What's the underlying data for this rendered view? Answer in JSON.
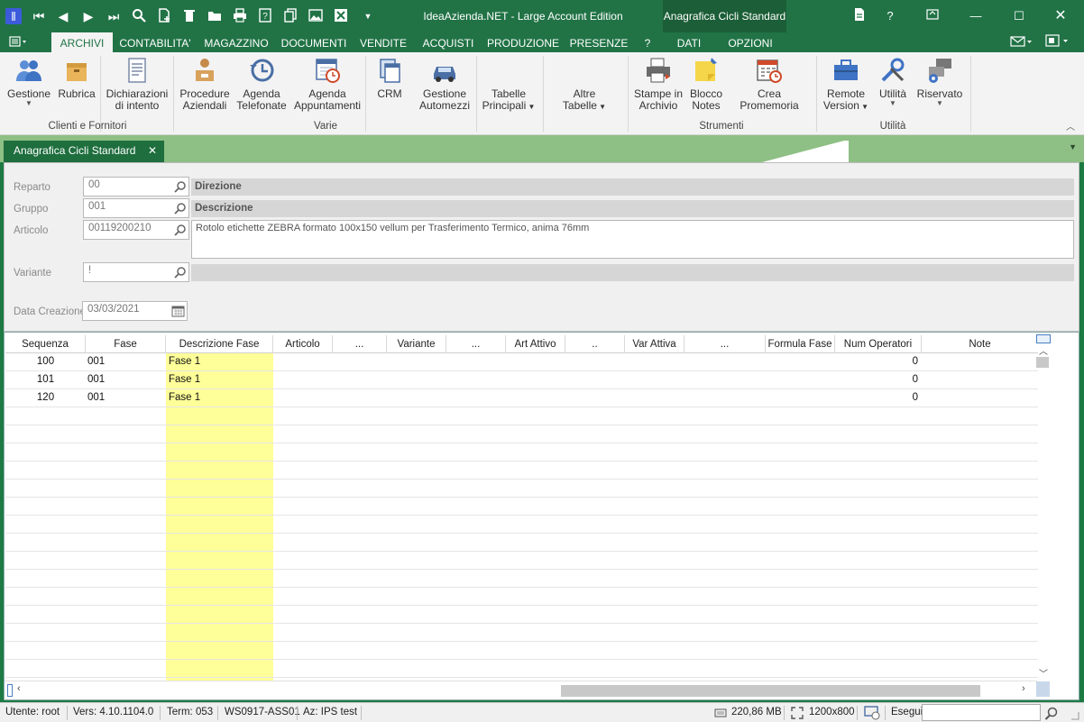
{
  "window": {
    "title": "IdeaAzienda.NET - Large Account Edition",
    "context_group": "Anagrafica Cicli Standard"
  },
  "quick_access": [
    "app-icon",
    "first-icon",
    "prev-icon",
    "next-icon",
    "last-icon",
    "search-icon",
    "new-icon",
    "delete-icon",
    "open-icon",
    "print-icon",
    "help-doc-icon",
    "copy-icon",
    "image-icon",
    "close-x-icon",
    "dropdown-icon"
  ],
  "window_controls": {
    "help": "?"
  },
  "ribbon_tabs": [
    "ARCHIVI",
    "CONTABILITA'",
    "MAGAZZINO",
    "DOCUMENTI",
    "VENDITE",
    "ACQUISTI",
    "PRODUZIONE",
    "PRESENZE",
    "?",
    "DATI",
    "OPZIONI"
  ],
  "ribbon": {
    "buttons": [
      {
        "label": "Gestione",
        "label2": "",
        "dropdown": true
      },
      {
        "label": "Rubrica",
        "label2": "",
        "dropdown": false
      },
      {
        "label": "Dichiarazioni",
        "label2": "di intento",
        "dropdown": false
      },
      {
        "label": "Procedure",
        "label2": "Aziendali",
        "dropdown": false
      },
      {
        "label": "Agenda",
        "label2": "Telefonate",
        "dropdown": false
      },
      {
        "label": "Agenda",
        "label2": "Appuntamenti",
        "dropdown": false
      },
      {
        "label": "CRM",
        "label2": "",
        "dropdown": false
      },
      {
        "label": "Gestione",
        "label2": "Automezzi",
        "dropdown": false
      },
      {
        "label": "Tabelle",
        "label2": "Principali",
        "dropdown": true
      },
      {
        "label": "Altre",
        "label2": "Tabelle",
        "dropdown": true
      },
      {
        "label": "Stampe in",
        "label2": "Archivio",
        "dropdown": false
      },
      {
        "label": "Blocco",
        "label2": "Notes",
        "dropdown": false
      },
      {
        "label": "Crea Promemoria",
        "label2": "",
        "dropdown": false
      },
      {
        "label": "Remote",
        "label2": "Version",
        "dropdown": true
      },
      {
        "label": "Utilità",
        "label2": "",
        "dropdown": true
      },
      {
        "label": "Riservato",
        "label2": "",
        "dropdown": true
      }
    ],
    "groups": [
      "Clienti e Fornitori",
      "Varie",
      "Strumenti",
      "Utilità"
    ]
  },
  "document_tab": {
    "label": "Anagrafica Cicli Standard",
    "close": "✕"
  },
  "form": {
    "reparto": {
      "label": "Reparto",
      "value": "00",
      "desc": "Direzione"
    },
    "gruppo": {
      "label": "Gruppo",
      "value": "001",
      "desc": "Descrizione"
    },
    "articolo": {
      "label": "Articolo",
      "value": "00119200210",
      "desc": "Rotolo etichette ZEBRA formato 100x150 vellum per Trasferimento Termico, anima 76mm"
    },
    "variante": {
      "label": "Variante",
      "value": "!",
      "desc": ""
    },
    "data_creazione": {
      "label": "Data Creazione",
      "value": "03/03/2021"
    }
  },
  "grid": {
    "columns": [
      "Sequenza",
      "Fase",
      "Descrizione Fase",
      "Articolo",
      "...",
      "Variante",
      "...",
      "Art Attivo",
      "..",
      "Var Attiva",
      "...",
      "Formula Fase",
      "Num Operatori",
      "Note"
    ],
    "rows": [
      {
        "sequenza": "100",
        "fase": "001",
        "descrizione": "Fase 1",
        "num_operatori": "0"
      },
      {
        "sequenza": "101",
        "fase": "001",
        "descrizione": "Fase 1",
        "num_operatori": "0"
      },
      {
        "sequenza": "120",
        "fase": "001",
        "descrizione": "Fase 1",
        "num_operatori": "0"
      }
    ],
    "empty_rows": 15
  },
  "status": {
    "utente": "Utente: root",
    "versione": "Vers: 4.10.1104.0",
    "term": "Term: 053",
    "workstation": "WS0917-ASS01",
    "azienda": "Az: IPS test",
    "memory": "220,86 MB",
    "resolution": "1200x800",
    "esegui": "Esegui",
    "esegui_value": ""
  },
  "colors": {
    "accent": "#217346",
    "strip": "#8ebf84",
    "highlight": "#ffff99"
  }
}
